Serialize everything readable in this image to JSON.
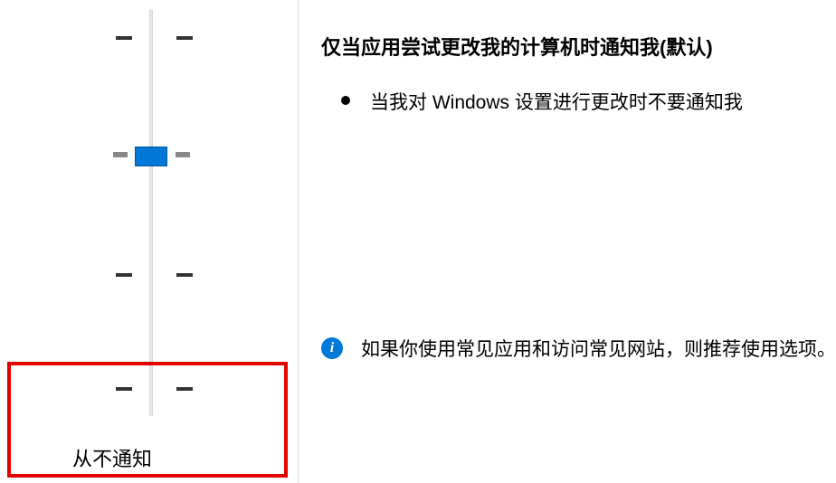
{
  "slider": {
    "bottom_label": "从不通知",
    "position": 1,
    "levels": 4
  },
  "content": {
    "heading": "仅当应用尝试更改我的计算机时通知我(默认)",
    "bullet1": "当我对 Windows 设置进行更改时不要通知我",
    "info_text": "如果你使用常见应用和访问常见网站，则推荐使用选项。"
  },
  "colors": {
    "accent": "#0078d7",
    "highlight": "#e20000"
  }
}
